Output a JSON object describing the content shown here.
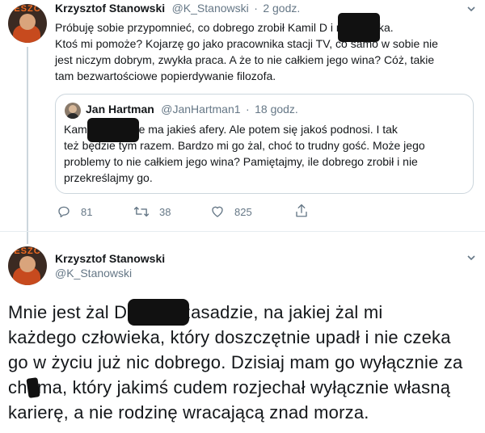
{
  "tweet1": {
    "author_name": "Krzysztof Stanowski",
    "author_handle": "@K_Stanowski",
    "separator": "·",
    "time": "2 godz.",
    "avatar_text": "ESZC",
    "text_lines": [
      "Próbuję sobie przypomnieć, co dobrego zrobił Kamil D        i nic, pustka.",
      "Ktoś mi pomoże? Kojarzę go jako pracownika stacji TV, co samo w sobie nie",
      "jest niczym dobrym, zwykła praca. A że to nie całkiem jego wina? Cóż, takie",
      "tam bezwartościowe popierdywanie filozofa."
    ],
    "quoted": {
      "author_name": "Jan Hartman",
      "author_handle": "@JanHartman1",
      "separator": "·",
      "time": "18 godz.",
      "text_lines": [
        "Kamil         całe życie ma jakieś afery. Ale potem się jakoś podnosi. I tak",
        "też będzie tym razem. Bardzo mi go żal, choć to trudny gość. Może jego",
        "problemy to nie całkiem jego wina? Pamiętajmy, ile dobrego zrobił i nie",
        "przekreślajmy go."
      ]
    },
    "actions": {
      "reply_count": "81",
      "retweet_count": "38",
      "like_count": "825"
    }
  },
  "tweet2": {
    "author_name": "Krzysztof Stanowski",
    "author_handle": "@K_Stanowski",
    "avatar_text": "ESZC",
    "text_lines": [
      "Mnie jest żal D              na tej zasadzie, na jakiej żal mi",
      "każdego człowieka, który doszczętnie upadł i nie czeka",
      "go w życiu już nic dobrego. Dzisiaj mam go wyłącznie za",
      "chama, który jakimś cudem rozjechał wyłącznie własną",
      "karierę, a nie rodzinę wracającą znad morza."
    ]
  },
  "colors": {
    "text": "#14171a",
    "secondary": "#657786",
    "border": "#ccd6dd",
    "redaction": "#111111"
  },
  "icons": [
    "reply-icon",
    "retweet-icon",
    "like-icon",
    "share-icon",
    "chevron-down-icon"
  ]
}
